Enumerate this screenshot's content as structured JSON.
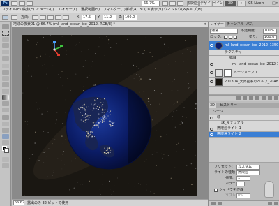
{
  "app": {
    "logo": "Ps",
    "zoom_value": "66.7%",
    "workspaces": [
      "初期設定",
      "デザイン",
      "ペイント",
      "写真",
      "3D"
    ],
    "active_workspace": "3D",
    "cslive": "CS Live ▾",
    "window_controls": [
      "–",
      "□",
      "×"
    ]
  },
  "menu": [
    "ファイル(F)",
    "編集(E)",
    "イメージ(I)",
    "レイヤー(L)",
    "選択範囲(S)",
    "フィルター(T)",
    "解析(A)",
    "3D(D)",
    "表示(V)",
    "ウィンドウ(W)",
    "ヘルプ(H)"
  ],
  "options": {
    "mode_label": "方向:",
    "x_value": "17.5",
    "y_value": "11.2",
    "z_value": "100.0"
  },
  "document": {
    "tab_label": "地球の夜景01 @ 66.7% (ml_land_ocean_ice_2012, RGB/8) *",
    "close": "×",
    "zoom_status": "66.67%",
    "doc_status": "露出のみ 32 ビットで使用"
  },
  "layers_panel": {
    "tabs": [
      "レイヤー",
      "チャンネル",
      "パス"
    ],
    "blend_mode": "通常",
    "opacity_label": "不透明度:",
    "opacity_value": "100%",
    "lock_label": "ロック:",
    "fill_label": "塗り:",
    "fill_value": "100%",
    "layers": [
      {
        "name": "ml_land_ocean_ice_2012_1350x675",
        "sub": "",
        "selected": true
      },
      {
        "name": "テクスチャ",
        "sub": "",
        "selected": false,
        "indent": 1
      },
      {
        "name": "拡散",
        "sub": "",
        "selected": false,
        "indent": 2
      },
      {
        "name": "ml_land_ocean_ice_2012 1350x675",
        "sub": "",
        "selected": false,
        "indent": 3
      },
      {
        "name": "トーンカーブ 1",
        "sub": "",
        "selected": false
      },
      {
        "name": "201304_天界星系のペルプ_2048X1536",
        "sub": "",
        "selected": false
      }
    ]
  },
  "threed_panel": {
    "tabs": [
      "3D",
      "ヒストリー"
    ],
    "scene_label": "シーン",
    "items": [
      {
        "name": "球",
        "selected": false
      },
      {
        "name": "球_マテリアル",
        "selected": false
      },
      {
        "name": "無限遠ライト 1",
        "selected": false
      },
      {
        "name": "無限遠ライト 2",
        "selected": true
      }
    ]
  },
  "light_props": {
    "preset_label": "プリセット:",
    "preset_value": "カスタム",
    "type_label": "ライトの種類:",
    "type_value": "無限遠",
    "intensity_label": "強度:",
    "intensity_value": "1",
    "color_label": "カラー:",
    "shadow_label": "シャドウを作成",
    "softness_label": "ソフト:",
    "softness_value": "0%"
  }
}
